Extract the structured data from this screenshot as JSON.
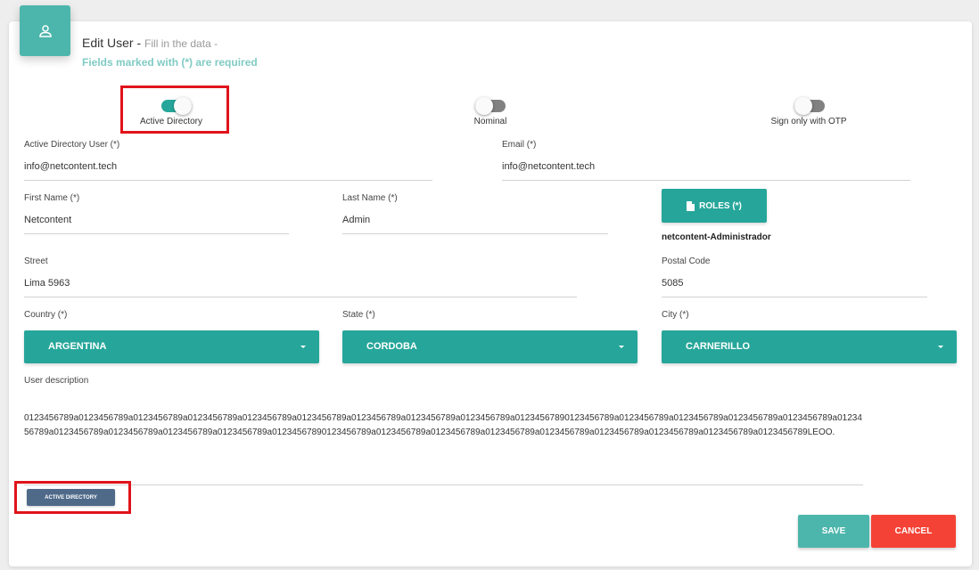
{
  "header": {
    "title": "Edit User",
    "separator": " - ",
    "subtitle": "Fill in the data -",
    "required_note": "Fields marked with (*) are required",
    "icon": "person-icon"
  },
  "toggles": [
    {
      "label": "Active Directory",
      "on": true
    },
    {
      "label": "Nominal",
      "on": false
    },
    {
      "label": "Sign only with OTP",
      "on": false
    }
  ],
  "fields": {
    "ad_user": {
      "label": "Active Directory User (*)",
      "value": "info@netcontent.tech"
    },
    "email": {
      "label": "Email (*)",
      "value": "info@netcontent.tech"
    },
    "first_name": {
      "label": "First Name (*)",
      "value": "Netcontent"
    },
    "last_name": {
      "label": "Last Name (*)",
      "value": "Admin"
    },
    "street": {
      "label": "Street",
      "value": "Lima 5963"
    },
    "postal_code": {
      "label": "Postal Code",
      "value": "5085"
    },
    "description": {
      "label": "User description",
      "value": "0123456789a0123456789a0123456789a0123456789a0123456789a0123456789a0123456789a0123456789a0123456789a01234567890123456789a0123456789a0123456789a0123456789a0123456789a0123456789a0123456789a0123456789a0123456789a0123456789a01234567890123456789a0123456789a0123456789a0123456789a0123456789a0123456789a0123456789a0123456789a0123456789LEOO."
    }
  },
  "roles": {
    "button_label": "ROLES (*)",
    "icon": "file-icon",
    "value": "netcontent-Administrador"
  },
  "selects": {
    "country": {
      "label": "Country (*)",
      "value": "ARGENTINA"
    },
    "state": {
      "label": "State (*)",
      "value": "CORDOBA"
    },
    "city": {
      "label": "City (*)",
      "value": "CARNERILLO"
    }
  },
  "buttons": {
    "active_directory": "ACTIVE DIRECTORY",
    "save": "SAVE",
    "cancel": "CANCEL"
  },
  "colors": {
    "primary": "#26a69a",
    "primary_light": "#4db6ac",
    "danger": "#f44336",
    "highlight": "#e0131a",
    "ad_button": "#4f6a89"
  }
}
